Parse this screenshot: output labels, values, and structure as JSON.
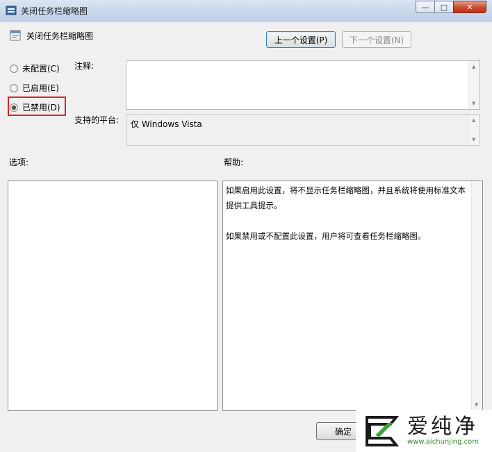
{
  "window": {
    "title": "关闭任务栏缩略图",
    "controls": {
      "minimize": "—",
      "maximize": "□",
      "close": "✕"
    }
  },
  "header": {
    "title": "关闭任务栏缩略图",
    "prev_button": "上一个设置(P)",
    "next_button": "下一个设置(N)"
  },
  "state": {
    "options": [
      {
        "label": "未配置(C)",
        "checked": false
      },
      {
        "label": "已启用(E)",
        "checked": false
      },
      {
        "label": "已禁用(D)",
        "checked": true
      }
    ]
  },
  "comment": {
    "label": "注释:",
    "value": ""
  },
  "platform": {
    "label": "支持的平台:",
    "value": "仅 Windows Vista"
  },
  "sections": {
    "options_label": "选项:",
    "help_label": "帮助:"
  },
  "help": {
    "paragraphs": [
      "如果启用此设置，将不显示任务栏缩略图，并且系统将使用标准文本提供工具提示。",
      "如果禁用或不配置此设置，用户将可查看任务栏缩略图。"
    ]
  },
  "footer": {
    "ok_button": "确定"
  },
  "watermark": {
    "brand": "爱纯净",
    "url": "www.aichunjing.com"
  },
  "colors": {
    "highlight": "#e02020",
    "watermark_green": "#2f8a2f"
  }
}
